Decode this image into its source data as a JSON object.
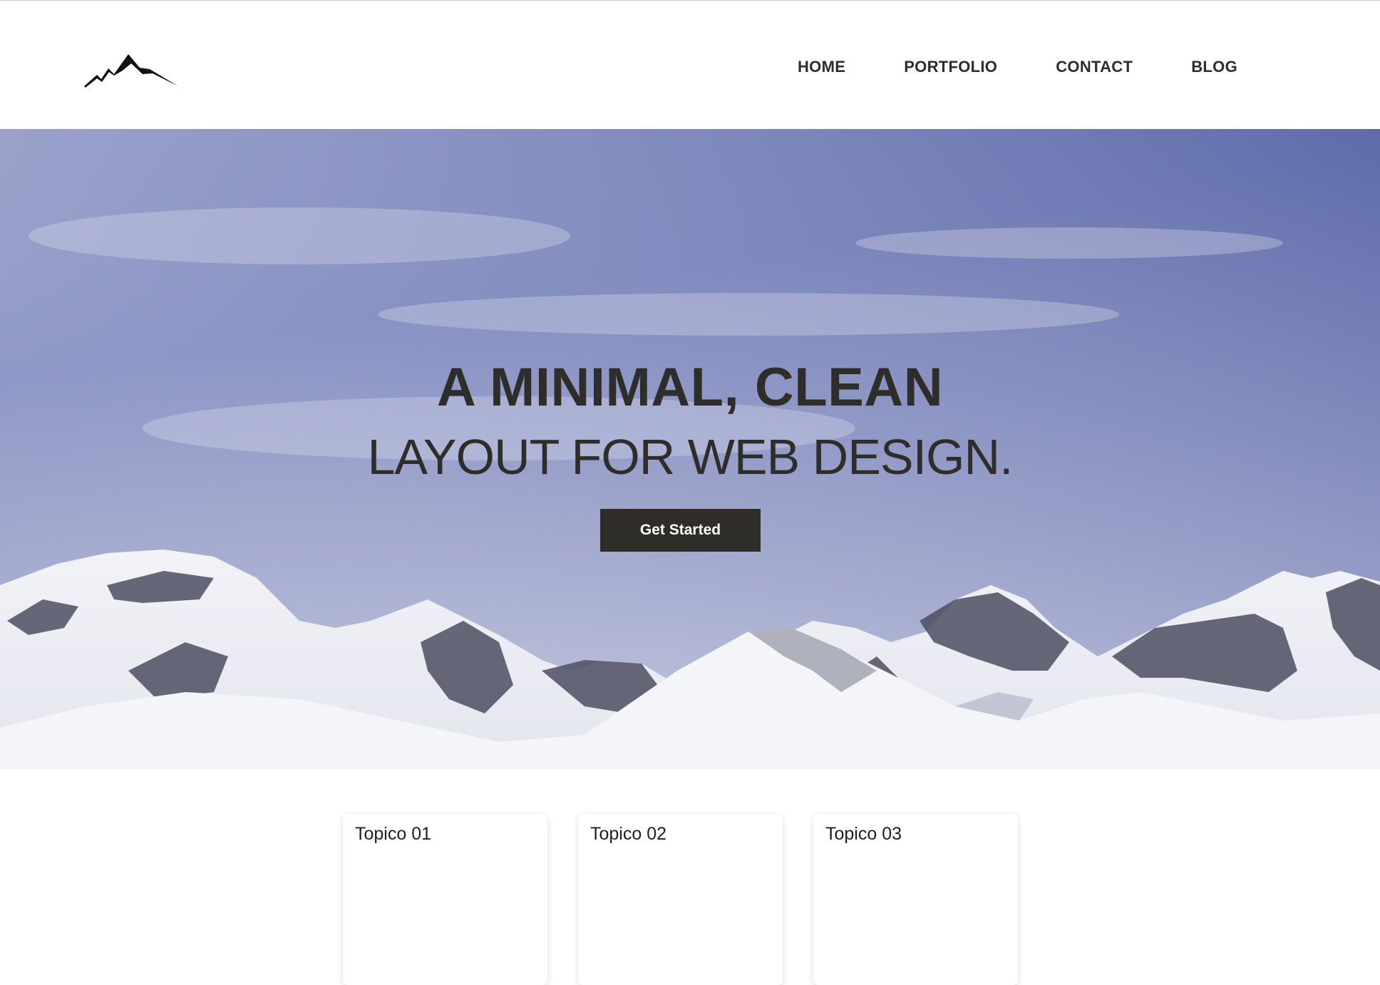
{
  "header": {
    "logo_icon": "mountain-logo-icon",
    "nav": [
      {
        "label": "HOME"
      },
      {
        "label": "PORTFOLIO"
      },
      {
        "label": "CONTACT"
      },
      {
        "label": "BLOG"
      }
    ]
  },
  "hero": {
    "title": "A MINIMAL, CLEAN",
    "subtitle": "LAYOUT FOR WEB DESIGN.",
    "cta_label": "Get Started",
    "background_image": "snowy-mountains-under-blue-sky"
  },
  "cards": [
    {
      "title": "Topico 01"
    },
    {
      "title": "Topico 02"
    },
    {
      "title": "Topico 03"
    }
  ],
  "colors": {
    "text_dark": "#2f2d2a",
    "button_bg": "#2f2d2a",
    "button_text": "#ffffff",
    "sky_top": "#5f6eaa",
    "sky_bottom": "#c9ccdf"
  }
}
